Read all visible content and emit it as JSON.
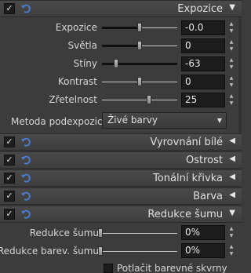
{
  "sections": {
    "exposure": {
      "title": "Expozice",
      "checked": true,
      "expanded": true
    },
    "white_balance": {
      "title": "Vyrovnání bílé",
      "checked": true,
      "expanded": false
    },
    "sharpness": {
      "title": "Ostrost",
      "checked": true,
      "expanded": false
    },
    "tone_curve": {
      "title": "Tonální křivka",
      "checked": true,
      "expanded": false
    },
    "color": {
      "title": "Barva",
      "checked": true,
      "expanded": false
    },
    "noise_reduction": {
      "title": "Redukce šumu",
      "checked": true,
      "expanded": true
    }
  },
  "exposure_sliders": [
    {
      "label": "Expozice",
      "value": "-0.0",
      "fraction": 0.5
    },
    {
      "label": "Světla",
      "value": "0",
      "fraction": 0.5
    },
    {
      "label": "Stíny",
      "value": "-63",
      "fraction": 0.18
    },
    {
      "label": "Kontrast",
      "value": "0",
      "fraction": 0.5
    },
    {
      "label": "Zřetelnost",
      "value": "25",
      "fraction": 0.625
    }
  ],
  "underexposure_method": {
    "label": "Metoda podexpozice",
    "selected": "Živé barvy"
  },
  "noise_sliders": [
    {
      "label": "Redukce šumu",
      "value": "0%",
      "fraction": 0
    },
    {
      "label": "Redukce barev. šumu",
      "value": "0%",
      "fraction": 0
    }
  ],
  "suppress_color_patches": {
    "label": "Potlačit barevné skvrny",
    "checked": false
  },
  "icons": {
    "check": "✓",
    "expanded_arrow": "▼",
    "collapsed_arrow": "◀",
    "dropdown_arrow": "▼",
    "spin_up": "▲",
    "spin_down": "▼",
    "undo": "undo-icon"
  },
  "colors": {
    "panel_bg": "#3c3c3c",
    "undo_icon": "#4a7fd6"
  }
}
